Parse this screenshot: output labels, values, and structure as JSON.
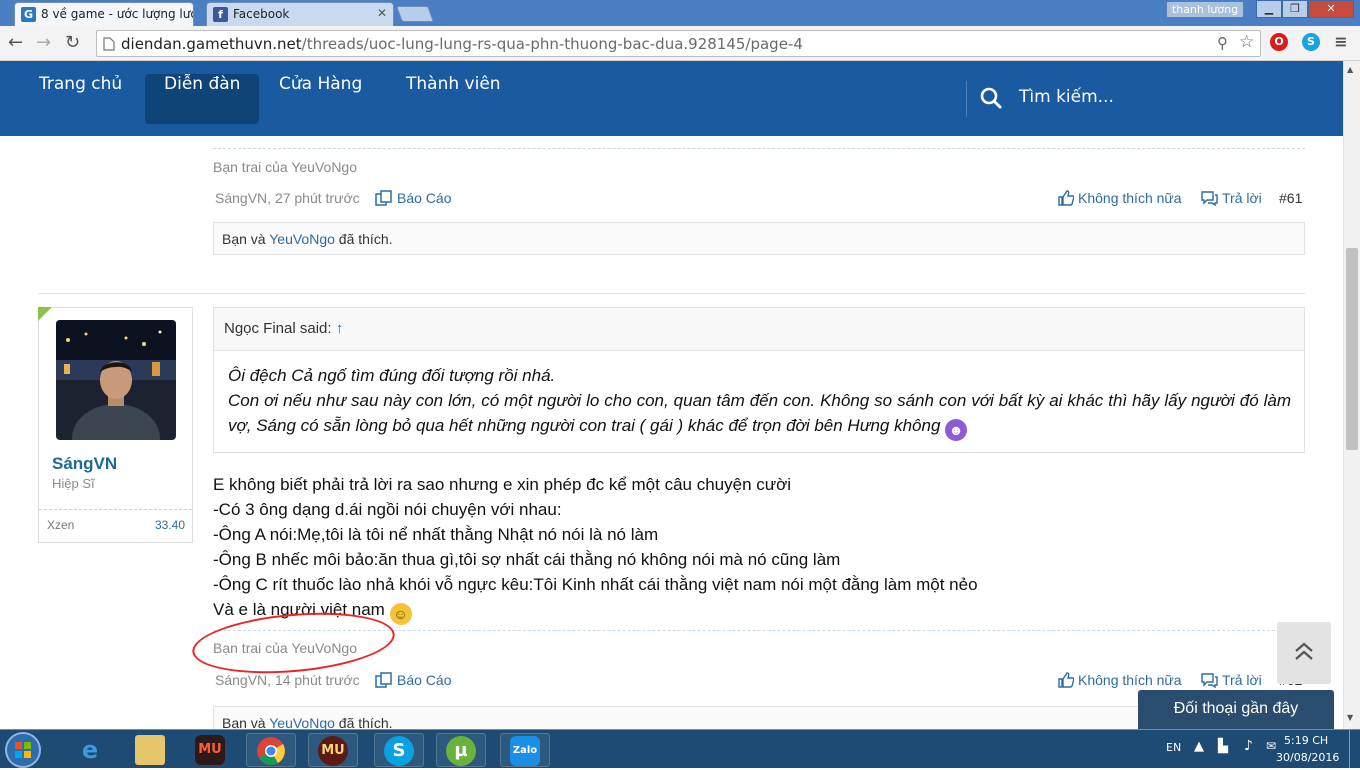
{
  "browser": {
    "tabs": [
      {
        "title": "8 về game - ước lượng lượ",
        "favicon": "G"
      },
      {
        "title": "Facebook",
        "favicon": "f"
      }
    ],
    "profile_name": "thanh lương",
    "url_host": "diendan.gamethuvn.net",
    "url_path": "/threads/uoc-lung-lung-rs-qua-phn-thuong-bac-dua.928145/page-4"
  },
  "site_nav": {
    "items": [
      "Trang chủ",
      "Diễn đàn",
      "Cửa Hàng",
      "Thành viên"
    ],
    "active_index": 1,
    "search_label": "Tìm kiếm..."
  },
  "post61": {
    "signature": "Bạn trai của YeuVoNgo",
    "author": "SángVN",
    "time": "27 phút trước",
    "report": "Báo Cáo",
    "unlike": "Không thích nữa",
    "reply": "Trả lời",
    "number": "#61",
    "likes_prefix": "Bạn và",
    "likes_user": "YeuVoNgo",
    "likes_suffix": "đã thích."
  },
  "post62": {
    "user": {
      "name": "SángVN",
      "rank": "Hiệp Sĩ",
      "stat_label": "Xzen",
      "stat_value": "33.40"
    },
    "quote_author": "Ngọc Final said:",
    "quote_arrow": "↑",
    "quote_line1": "Ôi đệch Cả ngố tìm đúng đối tượng rồi nhá.",
    "quote_line2": "Con ơi nếu như sau này con lớn, có một người lo cho con, quan tâm đến con. Không so sánh con với bất kỳ ai khác thì hãy lấy người đó làm vợ, Sáng có sẵn lòng bỏ qua hết những người con trai ( gái ) khác để trọn đời bên Hưng không",
    "body": [
      "E không biết phải trả lời ra sao nhưng e xin phép đc kể một câu chuyện cười",
      "-Có 3 ông dạng d.ái ngồi nói chuyện với nhau:",
      "-Ông A nói:Mẹ,tôi là tôi nể nhất thằng Nhật nó nói là nó làm",
      "-Ông B nhếc môi bảo:ăn thua gì,tôi sợ nhất cái thằng nó không nói mà nó cũng làm",
      "-Ông C rít thuốc lào nhả khói vỗ ngực kêu:Tôi Kinh nhất cái thằng việt nam nói một đằng làm một nẻo",
      "Và e là người việt nam"
    ],
    "signature": "Bạn trai của YeuVoNgo",
    "author": "SángVN",
    "time": "14 phút trước",
    "report": "Báo Cáo",
    "unlike": "Không thích nữa",
    "reply": "Trả lời",
    "number": "#62",
    "likes_prefix": "Bạn và",
    "likes_user": "YeuVoNgo",
    "likes_suffix": "đã thích."
  },
  "widgets": {
    "chat_label": "Đối thoại gần đây"
  },
  "taskbar": {
    "lang": "EN",
    "time": "5:19 CH",
    "date": "30/08/2016",
    "apps": [
      "internet-explorer",
      "file-explorer",
      "mu-game",
      "chrome",
      "mu-online",
      "skype",
      "utorrent",
      "zalo"
    ],
    "zalo_label": "Zalo",
    "mu_label": "MU"
  },
  "colors": {
    "nav_bg": "#1a5aa0",
    "nav_active": "#0f4479",
    "link": "#2d6ca2",
    "username": "#1d6a96",
    "annotation": "#e22222"
  }
}
